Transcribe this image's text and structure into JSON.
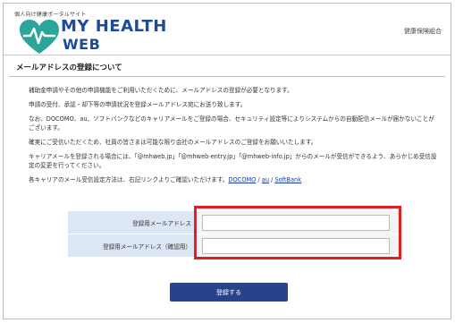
{
  "header": {
    "logo_subtitle": "個人向け健康ポータルサイト",
    "logo_title": "MY HEALTH",
    "logo_web": "WEB",
    "right_label": "健康保険組合",
    "heart_color": "#2aa59a",
    "brand_color": "#1e4a9a"
  },
  "page": {
    "title": "メールアドレスの登録について"
  },
  "content": {
    "p1": "補助金申請やその他の申請機能をご利用いただくために、メールアドレスの登録が必要となります。",
    "p2": "申請の受付、承認・却下等の申請状況を登録メールアドレス宛にお送り致します。",
    "p3": "なお、DOCOMO、au、ソフトバンクなどのキャリアメールをご登録の場合、セキュリティ設定等によりシステムからの自動配信メールが届かないことがございます。",
    "p4": "確実にご受信いただくため、社員の皆さまは可能な限り会社のメールアドレスのご登録をお願いいたします。",
    "p5": "キャリアメールを登録される場合には、「@mhweb.jp」「@mhweb-entry.jp」「@mhweb-info.jp」からのメールが受信ができるよう、あらかじめ受信設定の変更を行ってください。",
    "p6_text": "各キャリアのメール受信設定方法は、右記リンクよりご確認いただけます。",
    "link_docomo": "DOCOMO",
    "sep1": " / ",
    "link_au": "au",
    "sep2": " / ",
    "link_softbank": "SoftBank"
  },
  "form": {
    "email_label": "登録用メールアドレス",
    "email_value": "",
    "confirm_label": "登録用メールアドレス（確認用）",
    "confirm_value": "",
    "highlight_color": "#e02020"
  },
  "submit": {
    "label": "登録する",
    "color": "#27448a"
  }
}
